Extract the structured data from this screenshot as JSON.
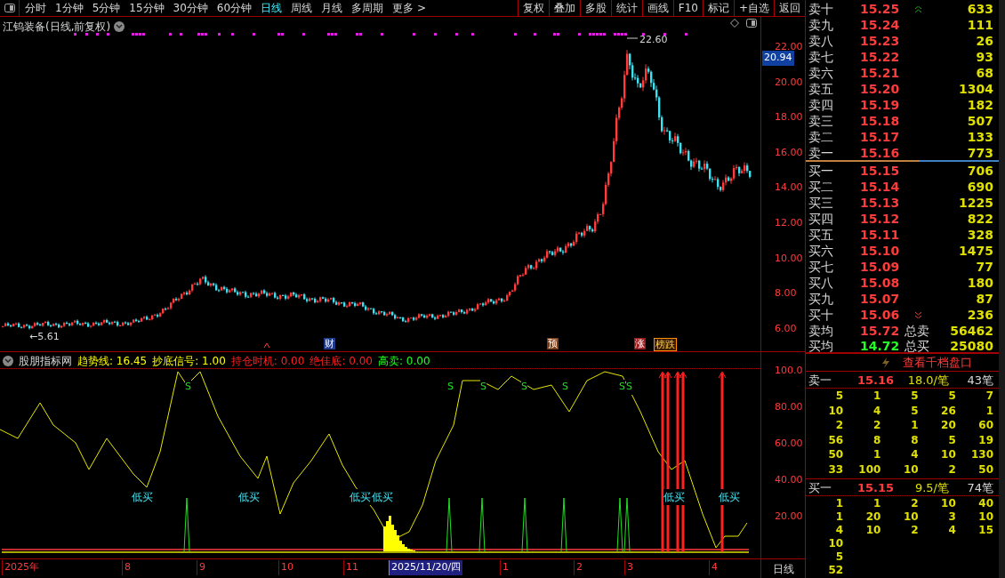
{
  "toolbar": {
    "periods": [
      {
        "label": "分时",
        "selected": false
      },
      {
        "label": "1分钟",
        "selected": false
      },
      {
        "label": "5分钟",
        "selected": false
      },
      {
        "label": "15分钟",
        "selected": false
      },
      {
        "label": "30分钟",
        "selected": false
      },
      {
        "label": "60分钟",
        "selected": false
      },
      {
        "label": "日线",
        "selected": true
      },
      {
        "label": "周线",
        "selected": false
      },
      {
        "label": "月线",
        "selected": false
      },
      {
        "label": "多周期",
        "selected": false
      },
      {
        "label": "更多 >",
        "selected": false
      }
    ],
    "actions": [
      "复权",
      "叠加",
      "多股",
      "统计",
      "画线",
      "F10",
      "标记",
      "+自选",
      "返回"
    ]
  },
  "chart": {
    "title": "江钨装备(日线,前复权)",
    "price_axis": [
      "22.00",
      "20.00",
      "18.00",
      "16.00",
      "14.00",
      "12.00",
      "10.00",
      "8.00",
      "6.00"
    ],
    "current_price": "20.94",
    "high_label": "22.60",
    "low_label": "←5.61",
    "event_markers": [
      {
        "text": "财",
        "color": "#1e3a8a"
      },
      {
        "text": "预",
        "color": "#7c3a12"
      },
      {
        "text": "涨",
        "color": "#991b1b"
      },
      {
        "text": "榜跌",
        "color": "#3a1a00"
      }
    ]
  },
  "indicator": {
    "name": "股朋指标网",
    "values": [
      {
        "text": "趋势线: 16.45",
        "color": "#ffff00"
      },
      {
        "text": "抄底信号: 1.00",
        "color": "#ffff00"
      },
      {
        "text": "持仓时机: 0.00",
        "color": "#ff2020"
      },
      {
        "text": "绝佳底: 0.00",
        "color": "#ff2020"
      },
      {
        "text": "高卖: 0.00",
        "color": "#20ff20"
      }
    ],
    "axis": [
      "100.0",
      "80.00",
      "60.00",
      "40.00",
      "20.00"
    ],
    "buy_labels": [
      "低买",
      "低买",
      "低买",
      "低买",
      "低买",
      "低买"
    ],
    "sell_labels": [
      "S",
      "S",
      "S",
      "S",
      "S",
      "S",
      "S"
    ]
  },
  "date_axis": {
    "labels": [
      {
        "text": "2025年",
        "selected": false
      },
      {
        "text": "8",
        "selected": false
      },
      {
        "text": "9",
        "selected": false
      },
      {
        "text": "10",
        "selected": false
      },
      {
        "text": "11",
        "selected": false
      },
      {
        "text": "2025/11/20/四",
        "selected": true
      },
      {
        "text": "1",
        "selected": false
      },
      {
        "text": "2",
        "selected": false
      },
      {
        "text": "3",
        "selected": false
      },
      {
        "text": "4",
        "selected": false
      }
    ],
    "period": "日线"
  },
  "order_book": {
    "asks": [
      {
        "label": "卖十",
        "price": "15.25",
        "volume": "633",
        "limit_up": true
      },
      {
        "label": "卖九",
        "price": "15.24",
        "volume": "111"
      },
      {
        "label": "卖八",
        "price": "15.23",
        "volume": "26"
      },
      {
        "label": "卖七",
        "price": "15.22",
        "volume": "93"
      },
      {
        "label": "卖六",
        "price": "15.21",
        "volume": "68"
      },
      {
        "label": "卖五",
        "price": "15.20",
        "volume": "1304"
      },
      {
        "label": "卖四",
        "price": "15.19",
        "volume": "182"
      },
      {
        "label": "卖三",
        "price": "15.18",
        "volume": "507"
      },
      {
        "label": "卖二",
        "price": "15.17",
        "volume": "133"
      },
      {
        "label": "卖一",
        "price": "15.16",
        "volume": "773"
      }
    ],
    "bids": [
      {
        "label": "买一",
        "price": "15.15",
        "volume": "706"
      },
      {
        "label": "买二",
        "price": "15.14",
        "volume": "690"
      },
      {
        "label": "买三",
        "price": "15.13",
        "volume": "1225"
      },
      {
        "label": "买四",
        "price": "15.12",
        "volume": "822"
      },
      {
        "label": "买五",
        "price": "15.11",
        "volume": "328"
      },
      {
        "label": "买六",
        "price": "15.10",
        "volume": "1475"
      },
      {
        "label": "买七",
        "price": "15.09",
        "volume": "77"
      },
      {
        "label": "买八",
        "price": "15.08",
        "volume": "180"
      },
      {
        "label": "买九",
        "price": "15.07",
        "volume": "87"
      },
      {
        "label": "买十",
        "price": "15.06",
        "volume": "236",
        "limit_down": true
      }
    ],
    "summary": [
      {
        "label": "卖均",
        "price": "15.72",
        "color": "#ff3b3b",
        "total_label": "总卖",
        "total": "56462"
      },
      {
        "label": "买均",
        "price": "14.72",
        "color": "#22ff22",
        "total_label": "总买",
        "total": "25080"
      }
    ]
  },
  "queue": {
    "button": "查看千档盘口",
    "sides": [
      {
        "label": "卖一",
        "price": "15.16",
        "average": "18.0/笔",
        "count": "43笔",
        "rows": [
          [
            "5",
            "1",
            "5",
            "5",
            "7"
          ],
          [
            "10",
            "4",
            "5",
            "26",
            "1"
          ],
          [
            "2",
            "2",
            "1",
            "20",
            "60"
          ],
          [
            "56",
            "8",
            "8",
            "5",
            "19"
          ],
          [
            "50",
            "1",
            "4",
            "10",
            "130"
          ],
          [
            "33",
            "100",
            "10",
            "2",
            "50"
          ]
        ]
      },
      {
        "label": "买一",
        "price": "15.15",
        "average": "9.5/笔",
        "count": "74笔",
        "rows": [
          [
            "1",
            "1",
            "2",
            "10",
            "40"
          ],
          [
            "1",
            "20",
            "10",
            "3",
            "10"
          ],
          [
            "4",
            "10",
            "2",
            "4",
            "15"
          ],
          [
            "10"
          ],
          [
            "5"
          ],
          [
            "52"
          ]
        ]
      }
    ]
  }
}
